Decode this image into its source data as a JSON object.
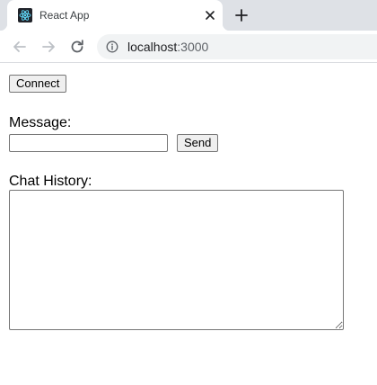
{
  "browser": {
    "tab": {
      "title": "React App"
    },
    "address_bar": {
      "host": "localhost",
      "port": ":3000"
    }
  },
  "app": {
    "connect_button_label": "Connect",
    "message_label": "Message:",
    "message_input_value": "",
    "send_button_label": "Send",
    "chat_history_label": "Chat History:",
    "chat_history_value": ""
  },
  "colors": {
    "tabstrip_bg": "#dee1e6",
    "omnibox_bg": "#f1f3f4",
    "react_logo": "#61dafb"
  }
}
